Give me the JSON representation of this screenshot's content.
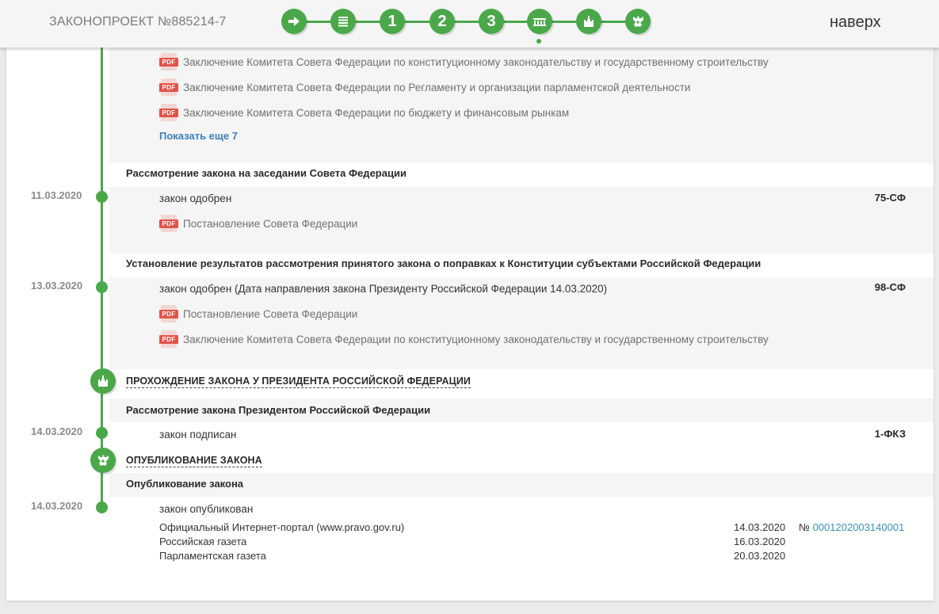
{
  "header": {
    "bill_title": "ЗАКОНОПРОЕКТ №885214-7",
    "steps": [
      {
        "kind": "arrow-icon"
      },
      {
        "kind": "document-stack-icon"
      },
      {
        "kind": "number",
        "label": "1"
      },
      {
        "kind": "number",
        "label": "2"
      },
      {
        "kind": "number",
        "label": "3"
      },
      {
        "kind": "council-icon",
        "active": true
      },
      {
        "kind": "kremlin-icon"
      },
      {
        "kind": "eagle-emblem-icon"
      }
    ],
    "up_link": "наверх"
  },
  "section0": {
    "docs": [
      "Заключение Комитета Совета Федерации по конституционному законодательству и государственному строительству",
      "Заключение Комитета Совета Федерации по Регламенту и организации парламентской деятельности",
      "Заключение Комитета Совета Федерации по бюджету и финансовым рынкам"
    ],
    "show_more": "Показать еще 7"
  },
  "section1": {
    "title": "Рассмотрение закона на заседании Совета Федерации",
    "date": "11.03.2020",
    "status": "закон одобрен",
    "code": "75-СФ",
    "docs": [
      "Постановление Совета Федерации"
    ]
  },
  "section2": {
    "title": "Установление результатов рассмотрения принятого закона о поправках к Конституции субъектами Российской Федерации",
    "date": "13.03.2020",
    "status": "закон одобрен (Дата направления закона Президенту Российской Федерации 14.03.2020)",
    "code": "98-СФ",
    "docs": [
      "Постановление Совета Федерации",
      "Заключение Комитета Совета Федерации по конституционному законодательству и государственному строительству"
    ]
  },
  "stage_president": {
    "title": "ПРОХОЖДЕНИЕ ЗАКОНА У ПРЕЗИДЕНТА РОССИЙСКОЙ ФЕДЕРАЦИИ",
    "sub_title": "Рассмотрение закона Президентом Российской Федерации",
    "date": "14.03.2020",
    "status": "закон подписан",
    "code": "1-ФКЗ"
  },
  "stage_publication": {
    "title": "ОПУБЛИКОВАНИЕ ЗАКОНА",
    "sub_title": "Опубликование закона",
    "date": "14.03.2020",
    "status": "закон опубликован",
    "sources": [
      {
        "name": "Официальный Интернет-портал (www.pravo.gov.ru)",
        "date": "14.03.2020",
        "num_prefix": "№",
        "num": "0001202003140001"
      },
      {
        "name": "Российская газета",
        "date": "16.03.2020"
      },
      {
        "name": "Парламентская газета",
        "date": "20.03.2020"
      }
    ]
  },
  "colors": {
    "accent": "#4aa84a",
    "link": "#3a7fbe",
    "pdf": "#e0544a"
  }
}
